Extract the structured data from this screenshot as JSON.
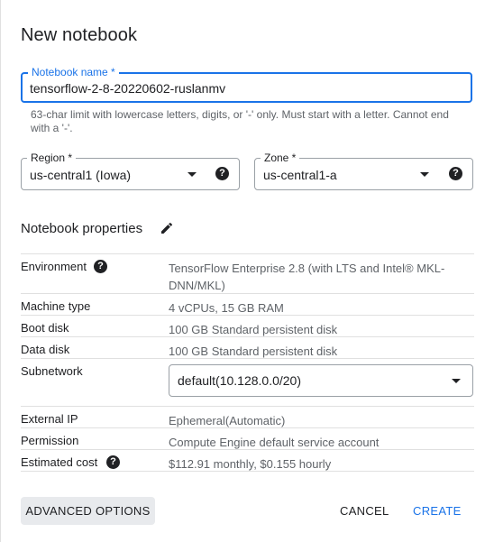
{
  "dialog": {
    "title": "New notebook"
  },
  "notebook_name": {
    "label": "Notebook name *",
    "value": "tensorflow-2-8-20220602-ruslanmv",
    "hint": "63-char limit with lowercase letters, digits, or '-' only. Must start with a letter. Cannot end with a '-'."
  },
  "region": {
    "label": "Region *",
    "value": "us-central1 (Iowa)"
  },
  "zone": {
    "label": "Zone *",
    "value": "us-central1-a"
  },
  "properties": {
    "title": "Notebook properties",
    "environment": {
      "key": "Environment",
      "value": "TensorFlow Enterprise 2.8 (with LTS and Intel® MKL-DNN/MKL)"
    },
    "machine_type": {
      "key": "Machine type",
      "value": "4 vCPUs, 15 GB RAM"
    },
    "boot_disk": {
      "key": "Boot disk",
      "value": "100 GB Standard persistent disk"
    },
    "data_disk": {
      "key": "Data disk",
      "value": "100 GB Standard persistent disk"
    },
    "subnetwork": {
      "key": "Subnetwork",
      "value": "default(10.128.0.0/20)"
    },
    "external_ip": {
      "key": "External IP",
      "value": "Ephemeral(Automatic)"
    },
    "permission": {
      "key": "Permission",
      "value": "Compute Engine default service account"
    },
    "estimated_cost": {
      "key": "Estimated cost",
      "value": "$112.91 monthly, $0.155 hourly"
    }
  },
  "buttons": {
    "advanced": "ADVANCED OPTIONS",
    "cancel": "CANCEL",
    "create": "CREATE"
  },
  "icons": {
    "help": "help-icon",
    "edit": "pencil-icon",
    "dropdown": "chevron-down-icon"
  },
  "colors": {
    "accent": "#1a73e8",
    "text": "#202124",
    "secondary_text": "#5f6368",
    "button_bg": "#e8eaed"
  }
}
